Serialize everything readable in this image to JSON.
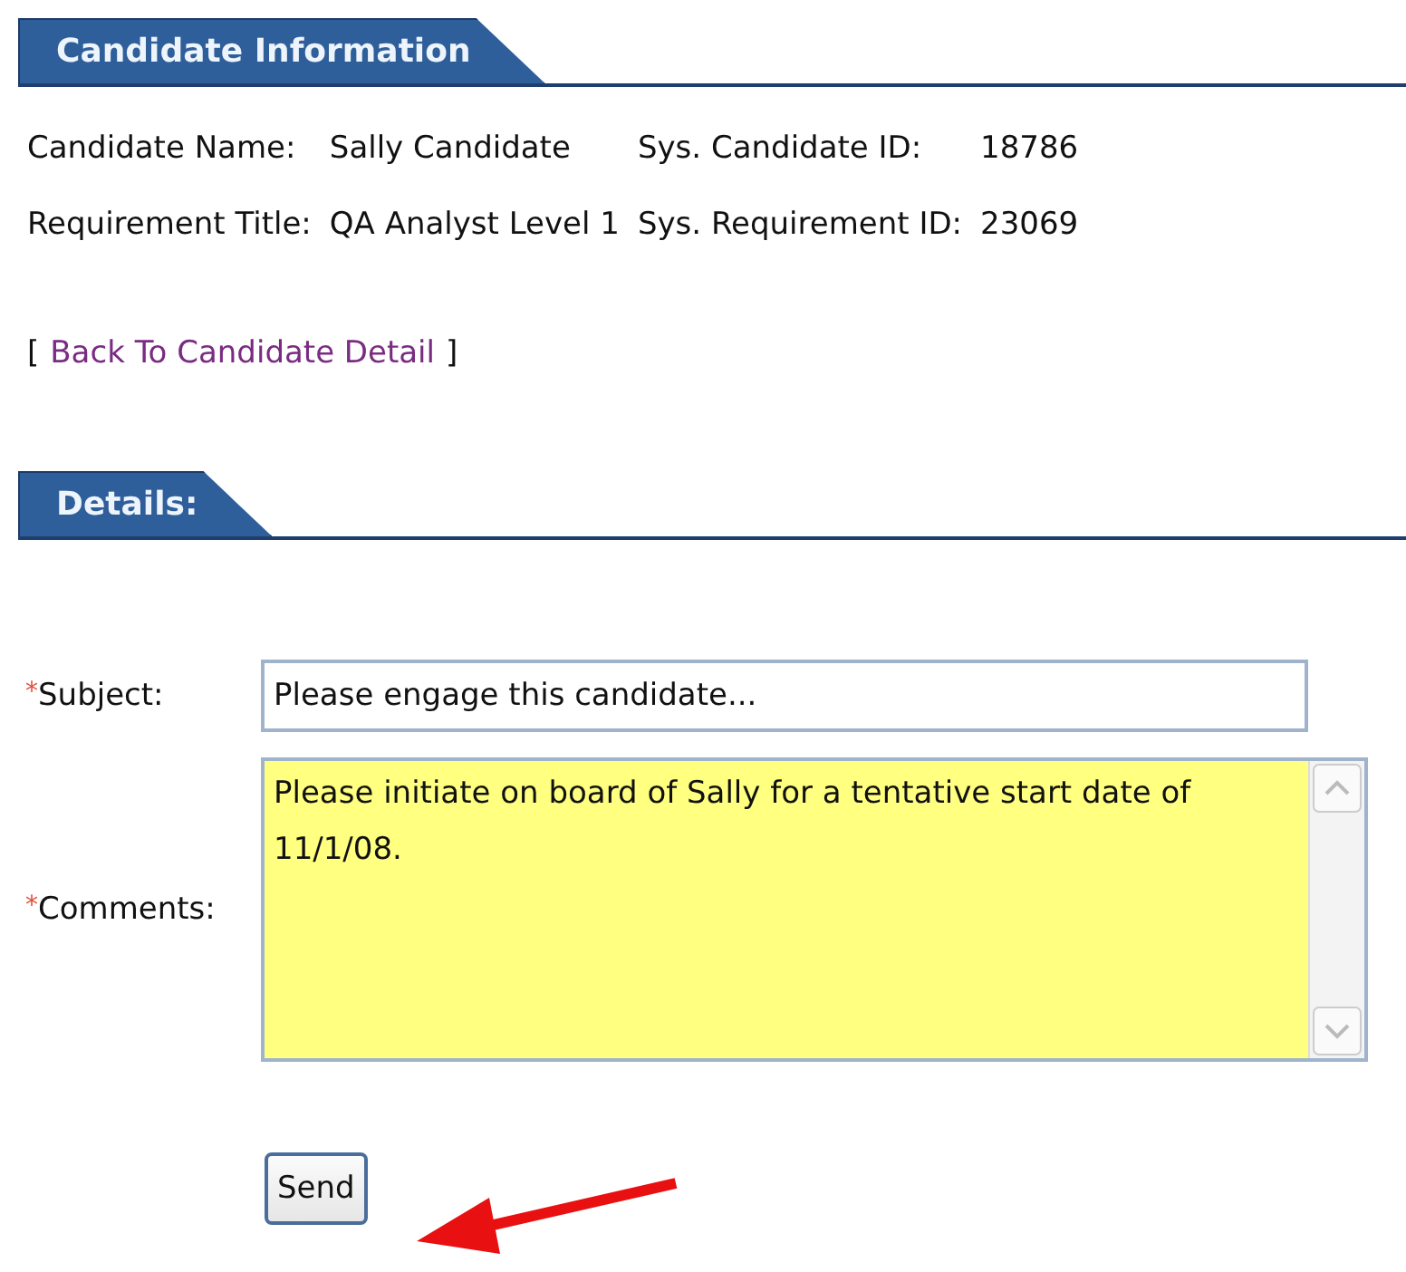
{
  "candidate_section": {
    "title": "Candidate Information",
    "fields": [
      {
        "label": "Candidate Name:",
        "value": "Sally Candidate"
      },
      {
        "label": "Sys. Candidate ID:",
        "value": "18786"
      },
      {
        "label": "Requirement Title:",
        "value": "QA Analyst Level 1"
      },
      {
        "label": "Sys. Requirement ID:",
        "value": "23069"
      }
    ],
    "back_link": {
      "open": "[",
      "label": "Back To Candidate Detail",
      "close": "]"
    }
  },
  "details_section": {
    "title": "Details:",
    "subject": {
      "required_mark": "*",
      "label": "Subject:",
      "value": "Please engage this candidate..."
    },
    "comments": {
      "required_mark": "*",
      "label": "Comments:",
      "value": "Please initiate on board of Sally for a tentative start date of 11/1/08."
    },
    "send_button": "Send"
  }
}
